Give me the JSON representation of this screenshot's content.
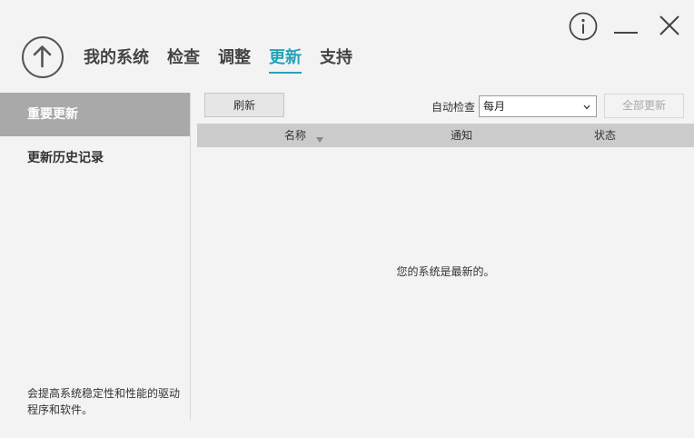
{
  "header": {
    "tabs": [
      {
        "label": "我的系统",
        "active": false
      },
      {
        "label": "检查",
        "active": false
      },
      {
        "label": "调整",
        "active": false
      },
      {
        "label": "更新",
        "active": true
      },
      {
        "label": "支持",
        "active": false
      }
    ],
    "accent_color": "#27a3b7",
    "icons": {
      "logo": "arrow-up-circle-icon",
      "info": "info-icon",
      "minimize": "minimize-icon",
      "close": "close-icon"
    }
  },
  "sidebar": {
    "items": [
      {
        "label": "重要更新",
        "active": true
      },
      {
        "label": "更新历史记录",
        "active": false
      }
    ],
    "description": "会提高系统稳定性和性能的驱动程序和软件。"
  },
  "main": {
    "toolbar": {
      "refresh_label": "刷新",
      "auto_check_label": "自动检查",
      "auto_check_value": "每月",
      "update_all_label": "全部更新"
    },
    "table": {
      "columns": [
        "名称",
        "通知",
        "状态"
      ],
      "rows": []
    },
    "empty_message": "您的系统是最新的。"
  }
}
